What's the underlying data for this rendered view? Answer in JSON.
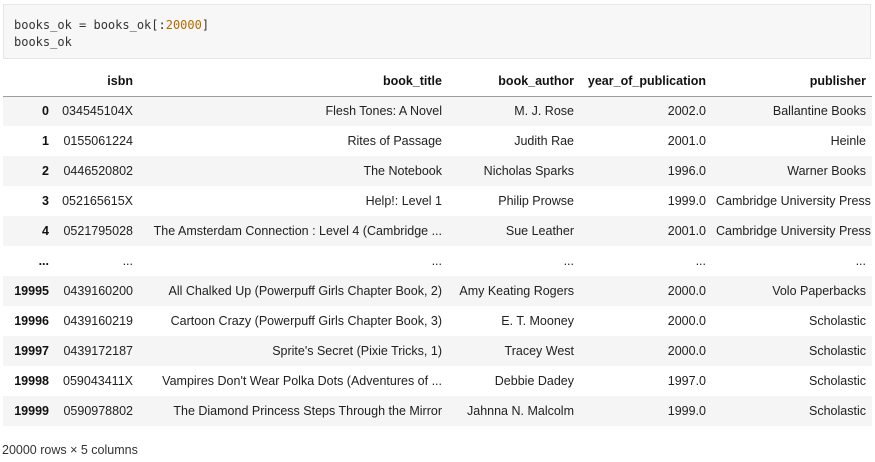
{
  "code_cell": {
    "line1_lhs": "books_ok",
    "line1_eq": " = ",
    "line1_obj": "books_ok",
    "line1_open": "[:",
    "line1_num": "20000",
    "line1_close": "]",
    "line2": "books_ok"
  },
  "table": {
    "columns": [
      "",
      "isbn",
      "book_title",
      "book_author",
      "year_of_publication",
      "publisher"
    ],
    "rows": [
      [
        "0",
        "034545104X",
        "Flesh Tones: A Novel",
        "M. J. Rose",
        "2002.0",
        "Ballantine Books"
      ],
      [
        "1",
        "0155061224",
        "Rites of Passage",
        "Judith Rae",
        "2001.0",
        "Heinle"
      ],
      [
        "2",
        "0446520802",
        "The Notebook",
        "Nicholas Sparks",
        "1996.0",
        "Warner Books"
      ],
      [
        "3",
        "052165615X",
        "Help!: Level 1",
        "Philip Prowse",
        "1999.0",
        "Cambridge University Press"
      ],
      [
        "4",
        "0521795028",
        "The Amsterdam Connection : Level 4 (Cambridge ...",
        "Sue Leather",
        "2001.0",
        "Cambridge University Press"
      ],
      [
        "...",
        "...",
        "...",
        "...",
        "...",
        "..."
      ],
      [
        "19995",
        "0439160200",
        "All Chalked Up (Powerpuff Girls Chapter Book, 2)",
        "Amy Keating Rogers",
        "2000.0",
        "Volo Paperbacks"
      ],
      [
        "19996",
        "0439160219",
        "Cartoon Crazy (Powerpuff Girls Chapter Book, 3)",
        "E. T. Mooney",
        "2000.0",
        "Scholastic"
      ],
      [
        "19997",
        "0439172187",
        "Sprite's Secret (Pixie Tricks, 1)",
        "Tracey West",
        "2000.0",
        "Scholastic"
      ],
      [
        "19998",
        "059043411X",
        "Vampires Don't Wear Polka Dots (Adventures of ...",
        "Debbie Dadey",
        "1997.0",
        "Scholastic"
      ],
      [
        "19999",
        "0590978802",
        "The Diamond Princess Steps Through the Mirror",
        "Jahnna N. Malcolm",
        "1999.0",
        "Scholastic"
      ]
    ]
  },
  "footer": "20000 rows × 5 columns"
}
